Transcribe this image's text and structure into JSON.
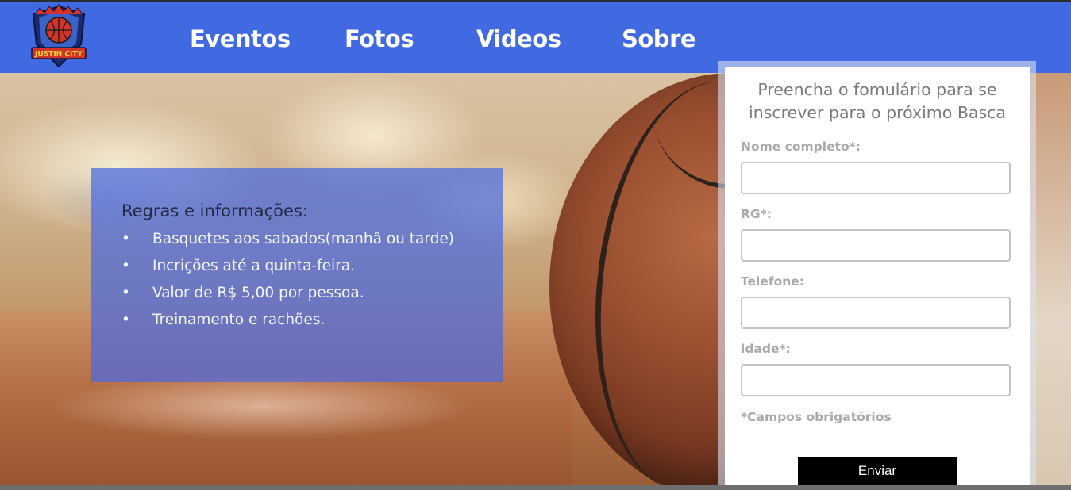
{
  "brand": {
    "logo_text": "JUSTIN CITY"
  },
  "nav": {
    "items": [
      "Eventos",
      "Fotos",
      "Videos",
      "Sobre"
    ]
  },
  "rules": {
    "title": "Regras e informações:",
    "bullet": "•",
    "items": [
      "Basquetes aos sabados(manhã ou tarde)",
      "Incrições até a quinta-feira.",
      "Valor de R$ 5,00 por pessoa.",
      "Treinamento e rachões."
    ]
  },
  "form": {
    "title_line1": "Preencha o fomulário para se",
    "title_line2": "inscrever para o próximo Basca",
    "fields": [
      {
        "label": "Nome completo*:",
        "value": ""
      },
      {
        "label": "RG*:",
        "value": ""
      },
      {
        "label": "Telefone:",
        "value": ""
      },
      {
        "label": "idade*:",
        "value": ""
      }
    ],
    "required_note": "*Campos obrigatórios",
    "submit_label": "Enviar"
  },
  "colors": {
    "header": "#4169e1",
    "panel": "#4b69e1",
    "button": "#000000"
  }
}
